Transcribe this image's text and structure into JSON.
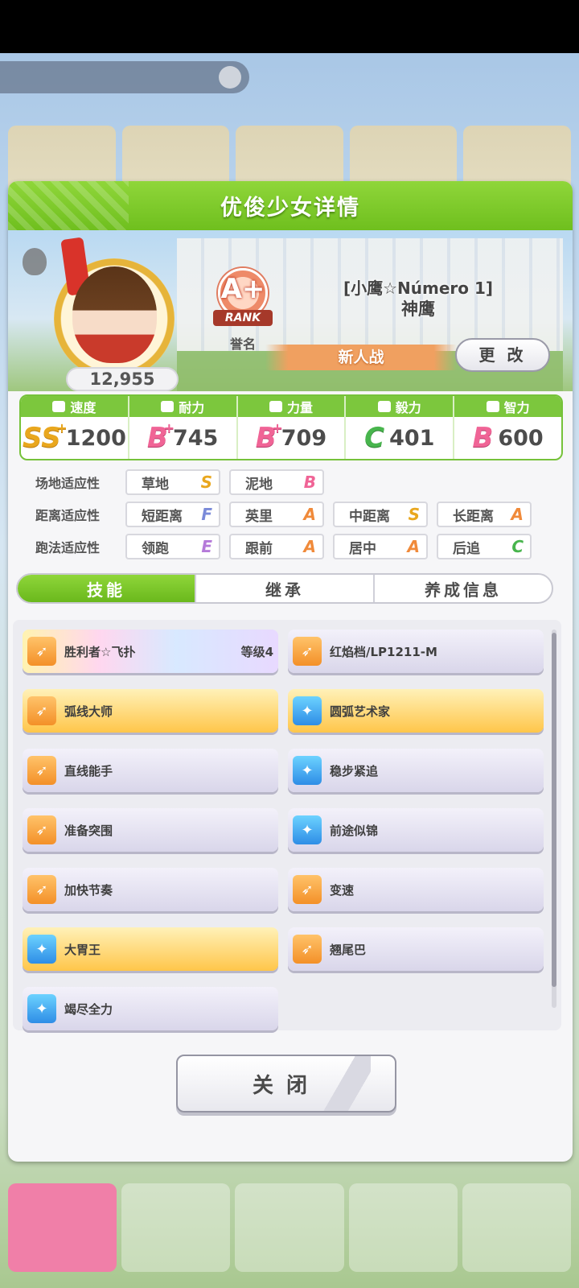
{
  "dialog": {
    "title": "优俊少女详情",
    "fans": "12,955",
    "rank": {
      "letter": "A+",
      "label": "RANK",
      "caption": "誉名"
    },
    "epithet": "[小鹰☆Número 1]",
    "name": "神鹰",
    "race_class": "新人战",
    "change_label": "更 改",
    "close_label": "关闭"
  },
  "stats": [
    {
      "name": "速度",
      "icon": "shoe-icon",
      "grade": "SS",
      "plus": "+",
      "value": "1200"
    },
    {
      "name": "耐力",
      "icon": "heart-icon",
      "grade": "B",
      "plus": "+",
      "value": "745"
    },
    {
      "name": "力量",
      "icon": "muscle-icon",
      "grade": "B",
      "plus": "+",
      "value": "709"
    },
    {
      "name": "毅力",
      "icon": "flame-icon",
      "grade": "C",
      "plus": "",
      "value": "401"
    },
    {
      "name": "智力",
      "icon": "graduation-cap-icon",
      "grade": "B",
      "plus": "",
      "value": "600"
    }
  ],
  "aptitude": {
    "track": {
      "label": "场地适应性",
      "items": [
        {
          "name": "草地",
          "grade": "S"
        },
        {
          "name": "泥地",
          "grade": "B"
        }
      ]
    },
    "distance": {
      "label": "距离适应性",
      "items": [
        {
          "name": "短距离",
          "grade": "F"
        },
        {
          "name": "英里",
          "grade": "A"
        },
        {
          "name": "中距离",
          "grade": "S"
        },
        {
          "name": "长距离",
          "grade": "A"
        }
      ]
    },
    "style": {
      "label": "跑法适应性",
      "items": [
        {
          "name": "领跑",
          "grade": "E"
        },
        {
          "name": "跟前",
          "grade": "A"
        },
        {
          "name": "居中",
          "grade": "A"
        },
        {
          "name": "后追",
          "grade": "C"
        }
      ]
    }
  },
  "tabs": [
    "技能",
    "继承",
    "养成信息"
  ],
  "skills": [
    {
      "name": "胜利者☆飞扑",
      "level": "等级4",
      "style": "rainbow",
      "icon": "orange"
    },
    {
      "name": "红焰档/LP1211-M",
      "level": "",
      "style": "normal",
      "icon": "orange"
    },
    {
      "name": "弧线大师",
      "level": "",
      "style": "gold",
      "icon": "orange"
    },
    {
      "name": "圆弧艺术家",
      "level": "",
      "style": "gold",
      "icon": "blue"
    },
    {
      "name": "直线能手",
      "level": "",
      "style": "normal",
      "icon": "orange"
    },
    {
      "name": "稳步紧追",
      "level": "",
      "style": "normal",
      "icon": "blue"
    },
    {
      "name": "准备突围",
      "level": "",
      "style": "normal",
      "icon": "orange"
    },
    {
      "name": "前途似锦",
      "level": "",
      "style": "normal",
      "icon": "blue"
    },
    {
      "name": "加快节奏",
      "level": "",
      "style": "normal",
      "icon": "orange"
    },
    {
      "name": "变速",
      "level": "",
      "style": "normal",
      "icon": "orange"
    },
    {
      "name": "大胃王",
      "level": "",
      "style": "gold",
      "icon": "blue"
    },
    {
      "name": "翘尾巴",
      "level": "",
      "style": "normal",
      "icon": "orange"
    },
    {
      "name": "竭尽全力",
      "level": "",
      "style": "normal",
      "icon": "blue"
    }
  ],
  "colors": {
    "header_green": "#7cc73d",
    "accent_orange": "#f0a060"
  }
}
